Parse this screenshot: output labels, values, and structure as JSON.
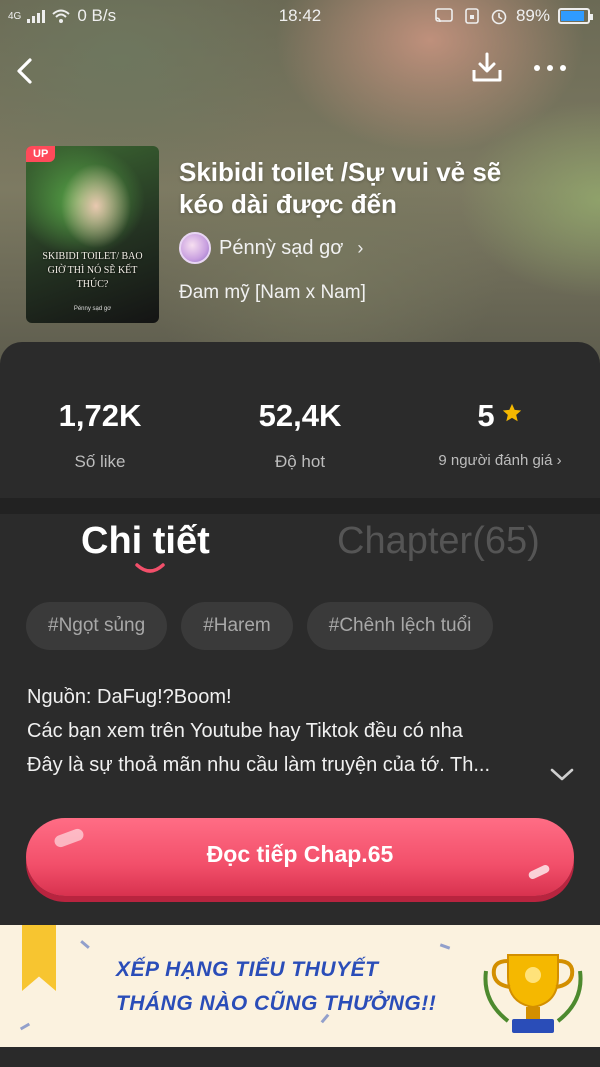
{
  "status_bar": {
    "network": "4G",
    "speed": "0 B/s",
    "time": "18:42",
    "battery": "89%",
    "battery_level": 0.89
  },
  "book": {
    "cover_badge": "UP",
    "cover_title": "SKIBIDI TOILET/ BAO GIỜ THÌ NÓ SẼ KẾT THÚC?",
    "cover_author": "Pénny sạd gơ",
    "title": "Skibidi toilet /Sự vui vẻ sẽ kéo dài được đến",
    "author": "Pénnỳ sạd gơ",
    "author_chevron": "›",
    "genre": "Đam mỹ [Nam x Nam]"
  },
  "stats": {
    "likes_value": "1,72K",
    "likes_label": "Số like",
    "hot_value": "52,4K",
    "hot_label": "Độ hot",
    "rating_value": "5",
    "rating_label": "9 người đánh giá ›"
  },
  "tabs": {
    "detail": "Chi tiết",
    "chapters": "Chapter(65)"
  },
  "tags": [
    "#Ngọt sủng",
    "#Harem",
    "#Chênh lệch tuổi"
  ],
  "description": [
    "Nguồn: DaFug!?Boom!",
    "Các bạn xem trên Youtube hay Tiktok đều có nha",
    "Đây là sự thoả mãn nhu cầu làm truyện của tớ. Th..."
  ],
  "cta": {
    "label": "Đọc tiếp Chap.65"
  },
  "banner": {
    "line1": "XẾP HẠNG TIỂU THUYẾT",
    "line2": "THÁNG NÀO CŨNG THƯỞNG!!"
  },
  "colors": {
    "accent": "#f24f6a",
    "star": "#f5b800",
    "banner_text": "#2a4db8",
    "panel": "#2b2b2b"
  },
  "icons": [
    "back-arrow-icon",
    "download-icon",
    "more-icon",
    "star-icon",
    "chevron-down-icon",
    "trophy-icon",
    "ribbon-icon"
  ]
}
